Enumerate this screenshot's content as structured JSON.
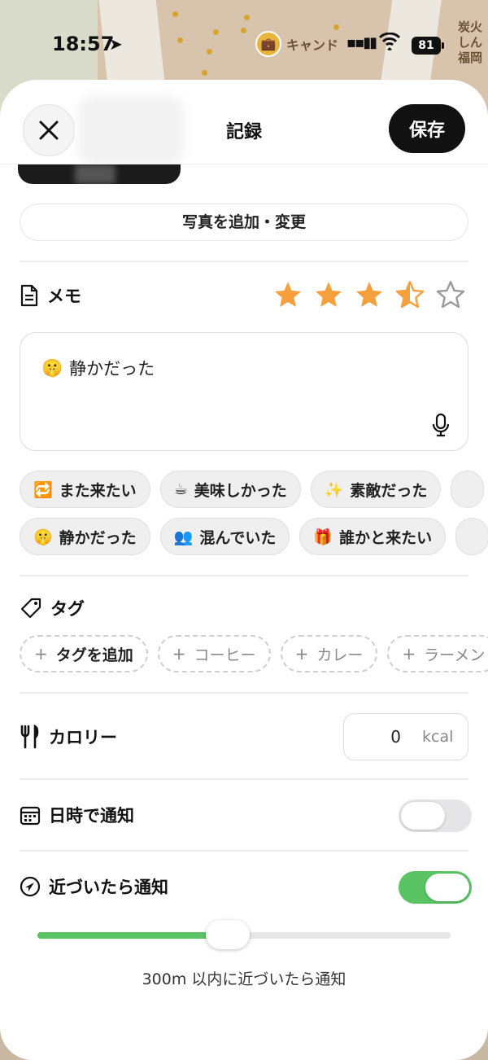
{
  "status_bar": {
    "time": "18:57",
    "battery": "81"
  },
  "map": {
    "poi_label": "キャンド",
    "poi2_lines": [
      "炭火",
      "しん",
      "福岡"
    ]
  },
  "header": {
    "title": "記録",
    "save_label": "保存"
  },
  "photo": {
    "add_change_label": "写真を追加・変更"
  },
  "memo": {
    "label": "メモ",
    "rating": 3.5,
    "rating_max": 5,
    "text": "静かだった",
    "text_emoji": "🤫"
  },
  "quick_chips": {
    "row1": [
      {
        "emoji": "🔁",
        "label": "また来たい"
      },
      {
        "emoji": "☕",
        "label": "美味しかった"
      },
      {
        "emoji": "✨",
        "label": "素敵だった"
      }
    ],
    "row2": [
      {
        "emoji": "🤫",
        "label": "静かだった"
      },
      {
        "emoji": "👥",
        "label": "混んでいた"
      },
      {
        "emoji": "🎁",
        "label": "誰かと来たい"
      }
    ]
  },
  "tags": {
    "label": "タグ",
    "add_label": "タグを追加",
    "suggestions": [
      "コーヒー",
      "カレー",
      "ラーメン"
    ]
  },
  "calorie": {
    "label": "カロリー",
    "value": "0",
    "unit": "kcal"
  },
  "datetime_notify": {
    "label": "日時で通知",
    "enabled": false
  },
  "proximity_notify": {
    "label": "近づいたら通知",
    "enabled": true,
    "slider_level": 0.46,
    "caption": "300m 以内に近づいたら通知"
  },
  "colors": {
    "star": "#f5a03c",
    "toggle_on": "#5ac364",
    "save_button": "#111111"
  }
}
